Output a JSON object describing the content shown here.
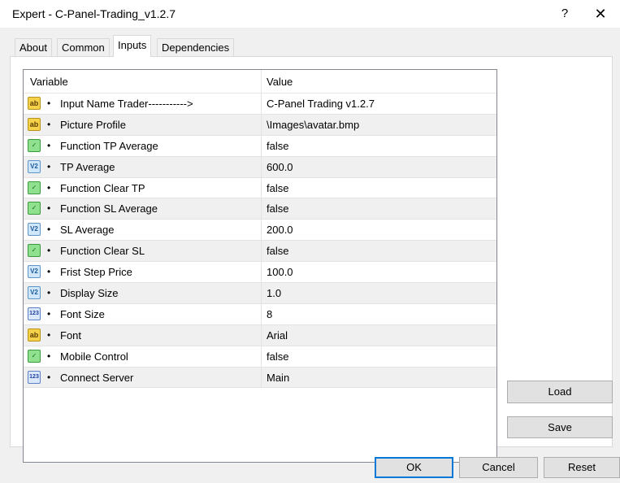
{
  "window": {
    "title": "Expert - C-Panel-Trading_v1.2.7",
    "help_label": "?",
    "close_label": "✕"
  },
  "tabs": [
    {
      "label": "About",
      "active": false
    },
    {
      "label": "Common",
      "active": false
    },
    {
      "label": "Inputs",
      "active": true
    },
    {
      "label": "Dependencies",
      "active": false
    }
  ],
  "grid": {
    "headers": {
      "variable": "Variable",
      "value": "Value"
    },
    "rows": [
      {
        "type": "string",
        "icon": "string-icon",
        "name": "Input Name Trader----------->",
        "value": "C-Panel Trading v1.2.7"
      },
      {
        "type": "string",
        "icon": "string-icon",
        "name": "Picture Profile",
        "value": "\\Images\\avatar.bmp"
      },
      {
        "type": "bool",
        "icon": "bool-icon",
        "name": "Function TP Average",
        "value": "false"
      },
      {
        "type": "double",
        "icon": "double-icon",
        "name": "TP Average",
        "value": "600.0"
      },
      {
        "type": "bool",
        "icon": "bool-icon",
        "name": "Function Clear TP",
        "value": "false"
      },
      {
        "type": "bool",
        "icon": "bool-icon",
        "name": "Function SL Average",
        "value": "false"
      },
      {
        "type": "double",
        "icon": "double-icon",
        "name": "SL Average",
        "value": "200.0"
      },
      {
        "type": "bool",
        "icon": "bool-icon",
        "name": "Function Clear SL",
        "value": "false"
      },
      {
        "type": "double",
        "icon": "double-icon",
        "name": "Frist Step Price",
        "value": "100.0"
      },
      {
        "type": "double",
        "icon": "double-icon",
        "name": "Display Size",
        "value": "1.0"
      },
      {
        "type": "int",
        "icon": "int-icon",
        "name": "Font Size",
        "value": "8"
      },
      {
        "type": "string",
        "icon": "string-icon",
        "name": "Font",
        "value": "Arial"
      },
      {
        "type": "bool",
        "icon": "bool-icon",
        "name": "Mobile Control",
        "value": "false"
      },
      {
        "type": "int",
        "icon": "int-icon",
        "name": "Connect Server",
        "value": "Main"
      }
    ]
  },
  "icon_glyphs": {
    "string": "ab",
    "bool": "✓",
    "double": "V2",
    "int": "123"
  },
  "buttons": {
    "load": "Load",
    "save": "Save",
    "ok": "OK",
    "cancel": "Cancel",
    "reset": "Reset"
  },
  "colors": {
    "accent": "#0078d7",
    "row_alt": "#f0f0f0"
  }
}
